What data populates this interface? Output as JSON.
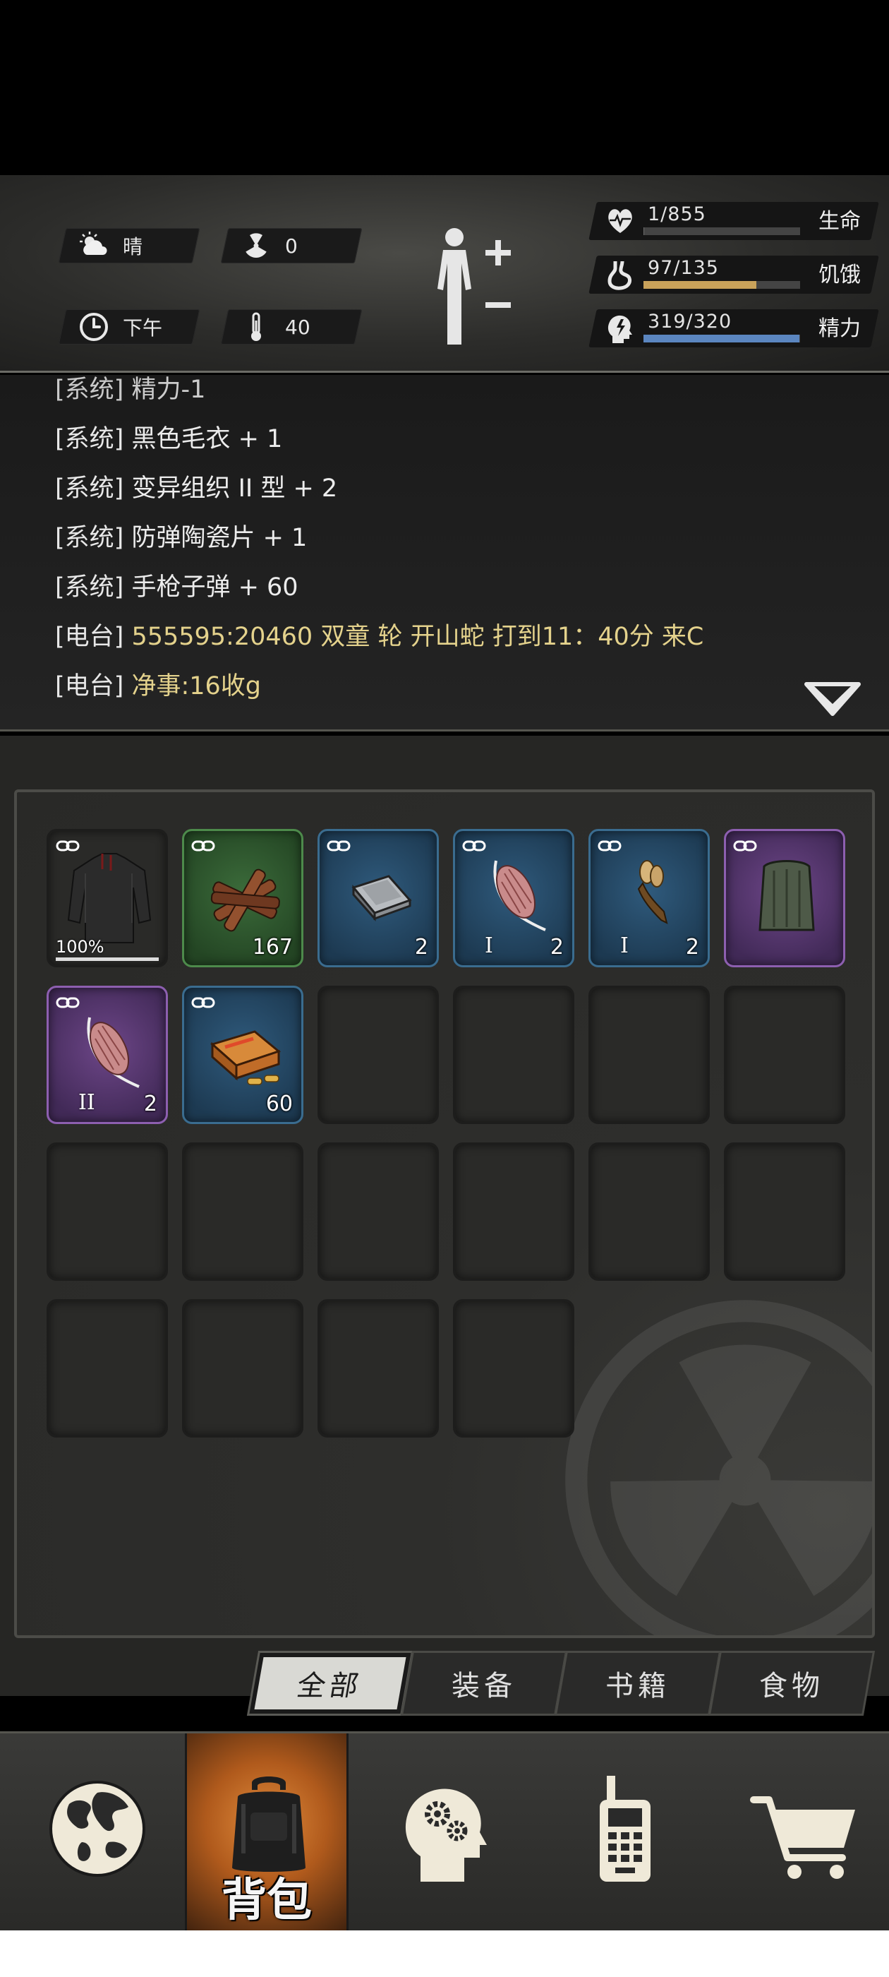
{
  "hud": {
    "weather": {
      "icon": "cloudy-sun-icon",
      "label": "晴"
    },
    "radiation": {
      "icon": "radiation-icon",
      "value": "0"
    },
    "time": {
      "icon": "clock-icon",
      "label": "下午"
    },
    "temperature": {
      "icon": "thermometer-icon",
      "value": "40"
    },
    "stats": [
      {
        "key": "health",
        "icon": "heartbeat-icon",
        "value": "1/855",
        "label": "生命",
        "fraction": 0.001,
        "color": "#6b6b6b"
      },
      {
        "key": "hunger",
        "icon": "stomach-icon",
        "value": "97/135",
        "label": "饥饿",
        "fraction": 0.72,
        "color": "#c9a25a"
      },
      {
        "key": "energy",
        "icon": "lightning-head-icon",
        "value": "319/320",
        "label": "精力",
        "fraction": 0.997,
        "color": "#5b86c0"
      }
    ]
  },
  "log": {
    "partial": {
      "tag": "[系统]",
      "text": "精力-1"
    },
    "lines": [
      {
        "tag": "[系统]",
        "text": "黑色毛衣 + 1"
      },
      {
        "tag": "[系统]",
        "text": "变异组织 II 型 + 2"
      },
      {
        "tag": "[系统]",
        "text": "防弹陶瓷片 + 1"
      },
      {
        "tag": "[系统]",
        "text": "手枪子弹 + 60"
      },
      {
        "tag": "[电台]",
        "text": "555595:20460 双童 轮 开山蛇 打到11：40分 来C"
      },
      {
        "tag": "[电台]",
        "text": "净事:16收g"
      }
    ]
  },
  "inventory": {
    "items": [
      {
        "name": "black-sweater",
        "rarity": "epic",
        "qty": "",
        "durability": "100%",
        "tier": ""
      },
      {
        "name": "firewood",
        "rarity": "common",
        "qty": "167",
        "durability": "",
        "tier": ""
      },
      {
        "name": "ceramic-plate",
        "rarity": "rare",
        "qty": "2",
        "durability": "",
        "tier": ""
      },
      {
        "name": "mutant-tissue-1",
        "rarity": "rare",
        "qty": "2",
        "durability": "",
        "tier": "I"
      },
      {
        "name": "mutant-claw-1",
        "rarity": "rare",
        "qty": "2",
        "durability": "",
        "tier": "I"
      },
      {
        "name": "armor-vest",
        "rarity": "epic",
        "qty": "",
        "durability": "",
        "tier": ""
      },
      {
        "name": "mutant-tissue-2",
        "rarity": "epic",
        "qty": "2",
        "durability": "",
        "tier": "II"
      },
      {
        "name": "pistol-ammo",
        "rarity": "rare",
        "qty": "60",
        "durability": "",
        "tier": ""
      }
    ],
    "empty_slots": 14
  },
  "tabs": [
    {
      "label": "全部",
      "active": true
    },
    {
      "label": "装备",
      "active": false
    },
    {
      "label": "书籍",
      "active": false
    },
    {
      "label": "食物",
      "active": false
    }
  ],
  "nav": [
    {
      "key": "map",
      "icon": "globe-icon",
      "label": "",
      "active": false
    },
    {
      "key": "backpack",
      "icon": "backpack-icon",
      "label": "背包",
      "active": true
    },
    {
      "key": "skills",
      "icon": "head-gears-icon",
      "label": "",
      "active": false
    },
    {
      "key": "radio",
      "icon": "walkie-talkie-icon",
      "label": "",
      "active": false
    },
    {
      "key": "shop",
      "icon": "shopping-cart-icon",
      "label": "",
      "active": false
    }
  ]
}
